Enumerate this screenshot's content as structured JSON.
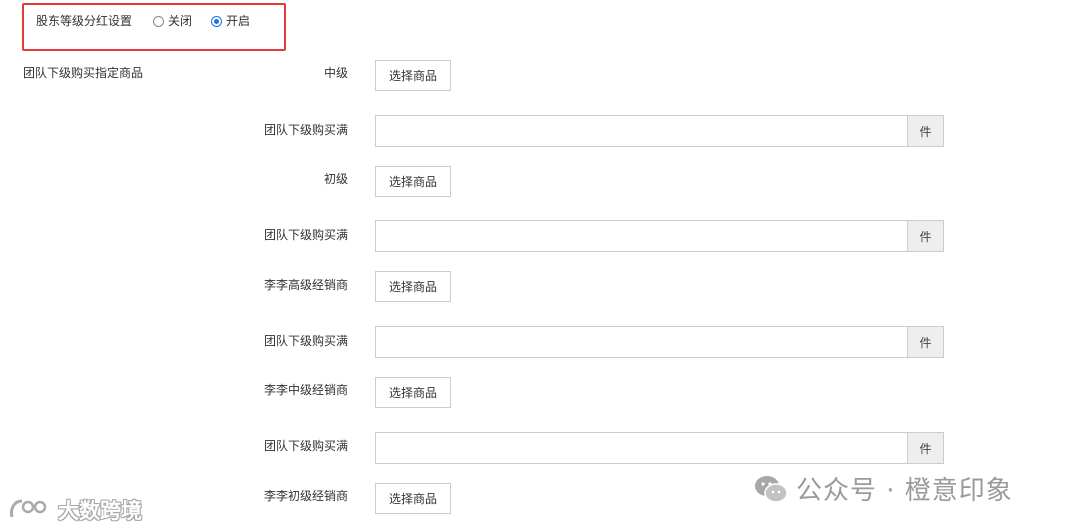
{
  "shareholder_dividend": {
    "label": "股东等级分红设置",
    "options": [
      {
        "label": "关闭",
        "checked": false
      },
      {
        "label": "开启",
        "checked": true
      }
    ]
  },
  "team_purchase": {
    "section_label": "团队下级购买指定商品",
    "select_button_label": "选择商品",
    "quantity_label": "团队下级购买满",
    "unit": "件",
    "levels": [
      {
        "name": "中级"
      },
      {
        "name": "初级"
      },
      {
        "name": "李李高级经销商"
      },
      {
        "name": "李李中级经销商"
      },
      {
        "name": "李李初级经销商"
      }
    ]
  },
  "watermarks": {
    "right": "公众号 · 橙意印象",
    "left": "大数跨境"
  },
  "colors": {
    "highlight_border": "#e53935",
    "radio_checked": "#1a73e8",
    "addon_bg": "#eeeeee"
  }
}
